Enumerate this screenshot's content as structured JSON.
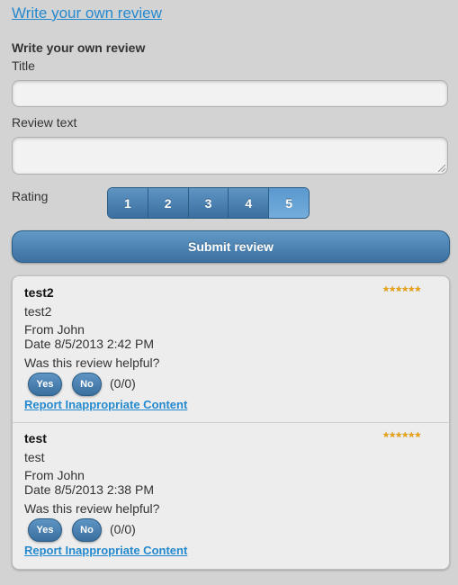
{
  "header": {
    "link_label": "Write your own review"
  },
  "form": {
    "heading": "Write your own review",
    "title_label": "Title",
    "title_value": "",
    "review_text_label": "Review text",
    "review_text_value": "",
    "rating_label": "Rating",
    "rating_options": [
      "1",
      "2",
      "3",
      "4",
      "5"
    ],
    "rating_selected": "5",
    "submit_label": "Submit review"
  },
  "reviews": [
    {
      "title": "test2",
      "body": "test2",
      "from": "From John",
      "date": "Date 8/5/2013 2:42 PM",
      "helpful_prompt": "Was this review helpful?",
      "yes_label": "Yes",
      "no_label": "No",
      "vote_count": "(0/0)",
      "report_label": "Report Inappropriate Content",
      "rating": 5,
      "stars": "★★★★★★",
      "star_color": "#e8a317"
    },
    {
      "title": "test",
      "body": "test",
      "from": "From John",
      "date": "Date 8/5/2013 2:38 PM",
      "helpful_prompt": "Was this review helpful?",
      "yes_label": "Yes",
      "no_label": "No",
      "vote_count": "(0/0)",
      "report_label": "Report Inappropriate Content",
      "rating": 5,
      "stars": "★★★★★★",
      "star_color": "#e8a317"
    }
  ],
  "colors": {
    "link": "#2489ce",
    "button_blue": "#3a6f9f",
    "background": "#d3d3d3"
  }
}
